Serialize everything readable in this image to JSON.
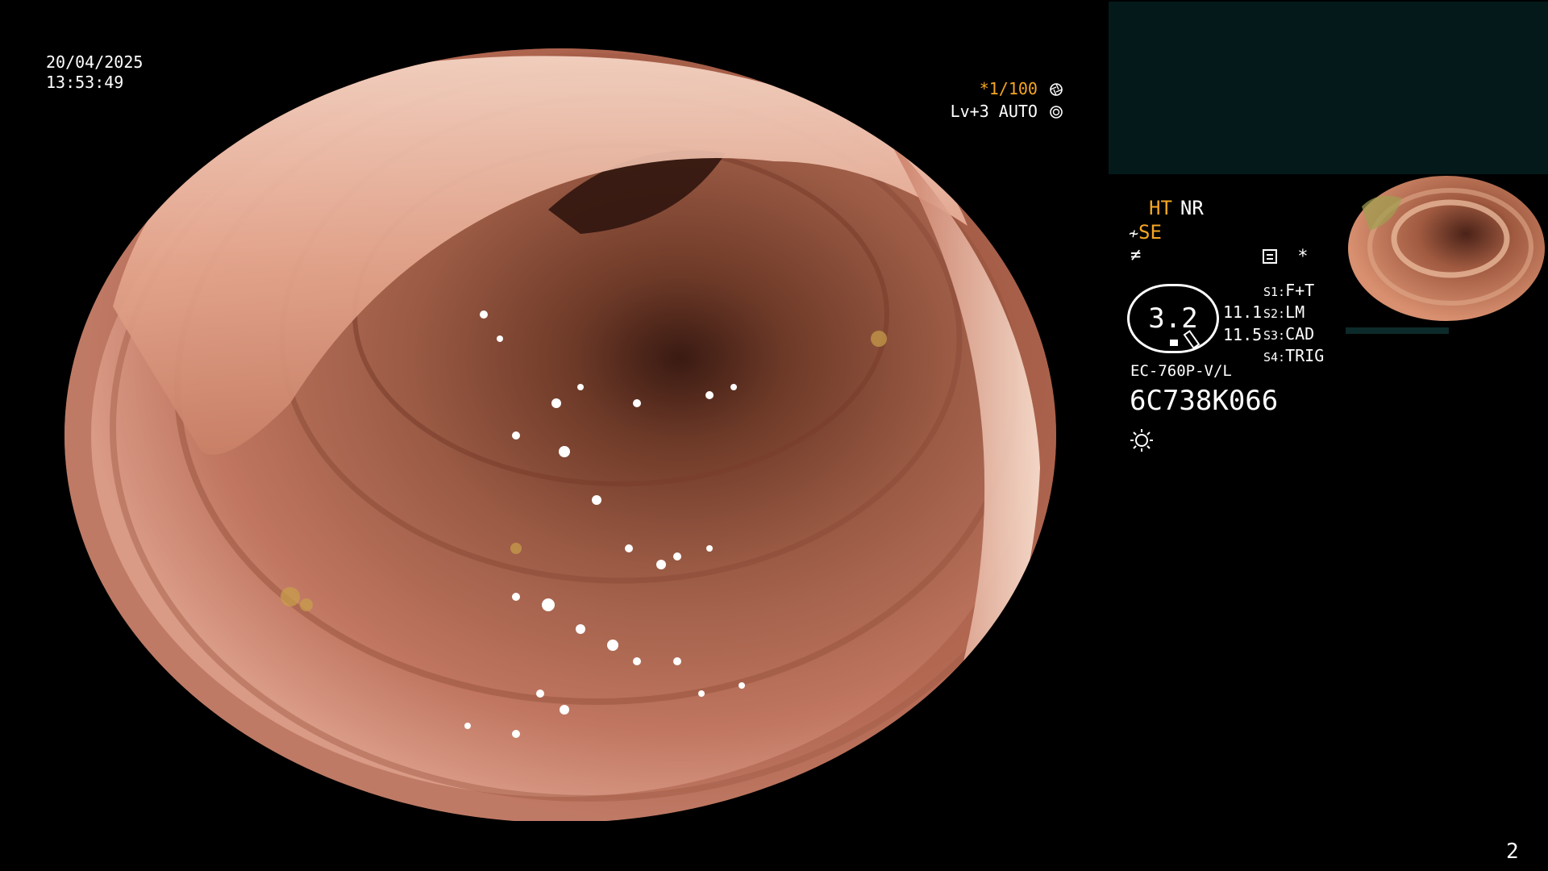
{
  "overlay": {
    "date": "20/04/2025",
    "time": "13:53:49",
    "shutter": "*1/100",
    "exposure": "Lv+3 AUTO",
    "shutter_icon": "aperture-icon",
    "exposure_icon": "target-icon"
  },
  "panel": {
    "mode_ht": "HT",
    "mode_nr": "NR",
    "mode_se": "SE",
    "mode_se_symbol": "≁",
    "mode_f_symbol": "≠",
    "settings_star": "*",
    "zoom": "3.2",
    "ratio_1": "11.1",
    "ratio_2": "11.5",
    "switches": [
      {
        "key": "S1:",
        "value": "F+T"
      },
      {
        "key": "S2:",
        "value": "LM"
      },
      {
        "key": "S3:",
        "value": "CAD"
      },
      {
        "key": "S4:",
        "value": "TRIG"
      }
    ],
    "scope_model": "EC-760P-V/L",
    "scope_serial": "6C738K066",
    "light_icon": "light-source-icon",
    "page_number": "2"
  },
  "colors": {
    "accent": "#f5a623",
    "pip_background": "#041a1a",
    "mucosa": "#b8624a"
  }
}
